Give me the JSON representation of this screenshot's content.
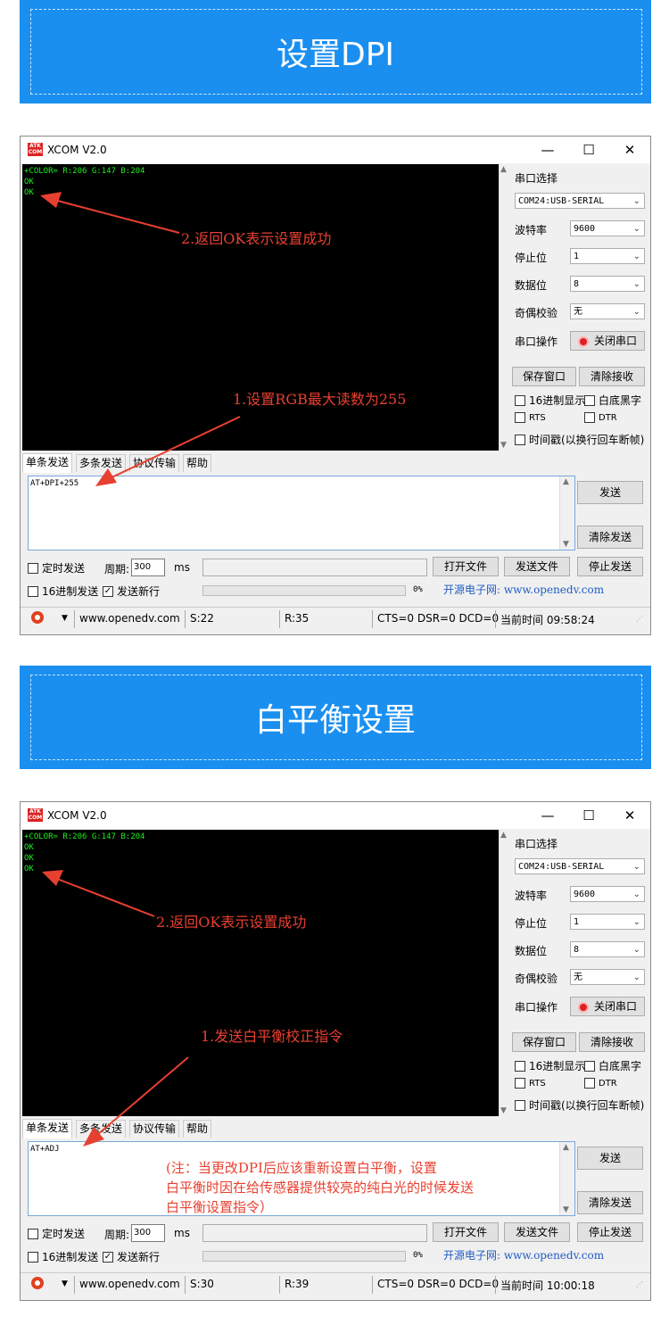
{
  "banner1": {
    "title": "设置DPI"
  },
  "banner2": {
    "title": "白平衡设置"
  },
  "window1": {
    "title": "XCOM V2.0",
    "logo_text": "ATK\nXCOM",
    "controls": {
      "minimize": "—",
      "maximize": "☐",
      "close": "✕"
    },
    "terminal_lines": [
      "+COLOR= R:206 G:147 B:204",
      "OK",
      "OK"
    ],
    "annotation_ok": "2.返回OK表示设置成功",
    "annotation_cmd": "1.设置RGB最大读数为255",
    "panel": {
      "port_label": "串口选择",
      "port_value": "COM24:USB-SERIAL",
      "baud_label": "波特率",
      "baud_value": "9600",
      "stop_label": "停止位",
      "stop_value": "1",
      "data_label": "数据位",
      "data_value": "8",
      "parity_label": "奇偶校验",
      "parity_value": "无",
      "op_label": "串口操作",
      "op_button": "关闭串口",
      "save_window": "保存窗口",
      "clear_recv": "清除接收",
      "hex_display": "16进制显示",
      "white_bg": "白底黑字",
      "rts": "RTS",
      "dtr": "DTR",
      "timestamp": "时间戳(以换行回车断帧)"
    },
    "tabs": [
      "单条发送",
      "多条发送",
      "协议传输",
      "帮助"
    ],
    "send_text": "AT+DPI+255",
    "send_button": "发送",
    "clear_send": "清除发送",
    "timed_send": "定时发送",
    "period_label": "周期:",
    "period_value": "300",
    "period_unit": "ms",
    "open_file": "打开文件",
    "send_file": "发送文件",
    "stop_send": "停止发送",
    "hex_send": "16进制发送",
    "newline_send": "发送新行",
    "progress_pct": "0%",
    "ad": "开源电子网: www.openedv.com",
    "status": {
      "url": "www.openedv.com",
      "s": "S:22",
      "r": "R:35",
      "lines": "CTS=0 DSR=0 DCD=0",
      "time": "当前时间 09:58:24"
    }
  },
  "window2": {
    "title": "XCOM V2.0",
    "logo_text": "ATK\nXCOM",
    "controls": {
      "minimize": "—",
      "maximize": "☐",
      "close": "✕"
    },
    "terminal_lines": [
      "+COLOR= R:206 G:147 B:204",
      "OK",
      "OK",
      "OK"
    ],
    "annotation_ok": "2.返回OK表示设置成功",
    "annotation_cmd": "1.发送白平衡校正指令",
    "note_lines": [
      "(注：当更改DPI后应该重新设置白平衡，设置",
      "白平衡时因在给传感器提供较亮的纯白光的时候发送",
      "白平衡设置指令）"
    ],
    "panel": {
      "port_label": "串口选择",
      "port_value": "COM24:USB-SERIAL",
      "baud_label": "波特率",
      "baud_value": "9600",
      "stop_label": "停止位",
      "stop_value": "1",
      "data_label": "数据位",
      "data_value": "8",
      "parity_label": "奇偶校验",
      "parity_value": "无",
      "op_label": "串口操作",
      "op_button": "关闭串口",
      "save_window": "保存窗口",
      "clear_recv": "清除接收",
      "hex_display": "16进制显示",
      "white_bg": "白底黑字",
      "rts": "RTS",
      "dtr": "DTR",
      "timestamp": "时间戳(以换行回车断帧)"
    },
    "tabs": [
      "单条发送",
      "多条发送",
      "协议传输",
      "帮助"
    ],
    "send_text": "AT+ADJ",
    "send_button": "发送",
    "clear_send": "清除发送",
    "timed_send": "定时发送",
    "period_label": "周期:",
    "period_value": "300",
    "period_unit": "ms",
    "open_file": "打开文件",
    "send_file": "发送文件",
    "stop_send": "停止发送",
    "hex_send": "16进制发送",
    "newline_send": "发送新行",
    "progress_pct": "0%",
    "ad": "开源电子网: www.openedv.com",
    "status": {
      "url": "www.openedv.com",
      "s": "S:30",
      "r": "R:39",
      "lines": "CTS=0 DSR=0 DCD=0",
      "time": "当前时间 10:00:18"
    }
  }
}
